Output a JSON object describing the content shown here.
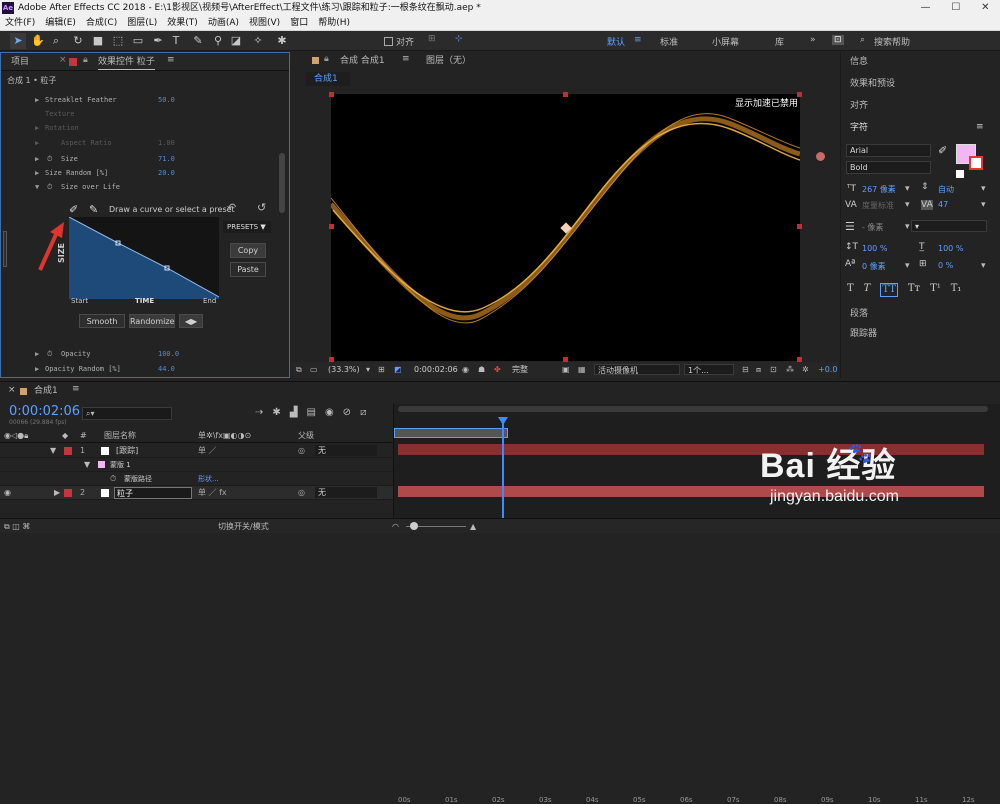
{
  "window": {
    "app_icon": "Ae",
    "title": "Adobe After Effects CC 2018 - E:\\1影视区\\视频号\\AfterEffect\\工程文件\\练习\\跟踪和粒子:一根条纹在飘动.aep *"
  },
  "menu": [
    "文件(F)",
    "编辑(E)",
    "合成(C)",
    "图层(L)",
    "效果(T)",
    "动画(A)",
    "视图(V)",
    "窗口",
    "帮助(H)"
  ],
  "toolbar": {
    "snap_label": "对齐",
    "workspaces": [
      "默认",
      "标准",
      "小屏幕",
      "库"
    ],
    "search_placeholder": "搜索帮助"
  },
  "left_panel": {
    "tab_project": "项目",
    "tab_effects": "效果控件 粒子",
    "breadcrumb": "合成 1 • 粒子",
    "rows": [
      {
        "name": "Streaklet Feather",
        "value": "50.0"
      },
      {
        "name": "Texture",
        "value": ""
      },
      {
        "name": "Rotation",
        "value": ""
      },
      {
        "name": "Aspect Ratio",
        "value": "1.00"
      },
      {
        "name": "Size",
        "value": "71.0"
      },
      {
        "name": "Size Random [%]",
        "value": "20.0"
      },
      {
        "name": "Size over Life",
        "value": ""
      }
    ],
    "curve_hint": "Draw a curve or select a preset",
    "presets_label": "PRESETS",
    "copy_label": "Copy",
    "paste_label": "Paste",
    "axis_y": "SIZE",
    "axis_x": "TIME",
    "x_start": "Start",
    "x_end": "End",
    "smooth_label": "Smooth",
    "randomize_label": "Randomize",
    "opacity_rows": [
      {
        "name": "Opacity",
        "value": "100.0"
      },
      {
        "name": "Opacity Random [%]",
        "value": "44.0"
      }
    ]
  },
  "comp_panel": {
    "tab_comp": "合成 合成1",
    "tab_layer": "图层（无）",
    "subtab": "合成1",
    "gpu_notice": "显示加速已禁用",
    "zoom": "(33.3%)",
    "timecode": "0:00:02:06",
    "quality": "完整",
    "camera": "活动摄像机",
    "views": "1个...",
    "exposure": "+0.0"
  },
  "right_panel": {
    "sections": [
      "信息",
      "效果和预设",
      "对齐"
    ],
    "char_title": "字符",
    "font": "Arial",
    "style": "Bold",
    "size": "267 像素",
    "leading": "自动",
    "kerning": "度量标准",
    "tracking": "47",
    "stroke_width": "- 像素",
    "vscale": "100 %",
    "hscale": "100 %",
    "baseline": "0 像素",
    "tsume": "0 %",
    "text_buttons": [
      "T",
      "T",
      "TT",
      "Tт",
      "T¹",
      "T₁"
    ],
    "para_title": "段落",
    "tracker_title": "跟踪器",
    "fill_color": "#f2b7f2"
  },
  "timeline": {
    "comp_tab": "合成1",
    "timecode": "0:00:02:06",
    "frames": "00066 (29.884 fps)",
    "col_num": "#",
    "col_name": "图层名称",
    "col_parent": "父级",
    "ticks": [
      "00s",
      "01s",
      "02s",
      "03s",
      "04s",
      "05s",
      "06s",
      "07s",
      "08s",
      "09s",
      "10s",
      "11s",
      "12s"
    ],
    "layers": [
      {
        "num": "1",
        "name": "[跟踪]",
        "parent": "无"
      },
      {
        "num": "",
        "name": "蒙版 1",
        "parent": ""
      },
      {
        "num": "",
        "name": "蒙版路径",
        "parent": "形状..."
      },
      {
        "num": "2",
        "name": "粒子",
        "parent": "无"
      }
    ],
    "footer_mode": "切换开关/模式"
  },
  "watermark": {
    "brand": "Bai 经验",
    "url": "jingyan.baidu.com"
  }
}
